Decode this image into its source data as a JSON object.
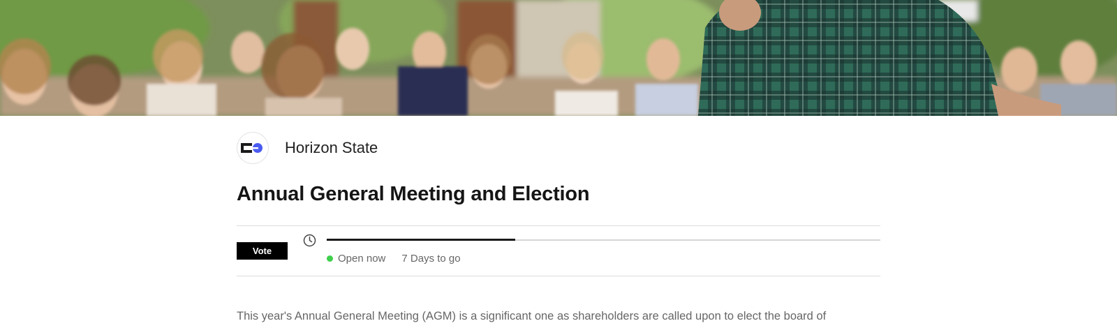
{
  "hero": {
    "image_description_icon": "audience-photo"
  },
  "organization": {
    "name": "Horizon State",
    "logo_icon": "horizon-state-logo"
  },
  "poll": {
    "title": "Annual General Meeting and Election",
    "vote_label": "Vote",
    "status_text": "Open now",
    "status_color": "#3ecf4c",
    "time_remaining": "7 Days to go",
    "progress_fraction": 0.34,
    "clock_icon": "clock-icon"
  },
  "body": {
    "description": "This year's Annual General Meeting (AGM) is a significant one as shareholders are called upon to elect the board of"
  },
  "colors": {
    "accent": "#000000",
    "logo_blue": "#4a5cf0",
    "divider": "#dcdcdc"
  }
}
